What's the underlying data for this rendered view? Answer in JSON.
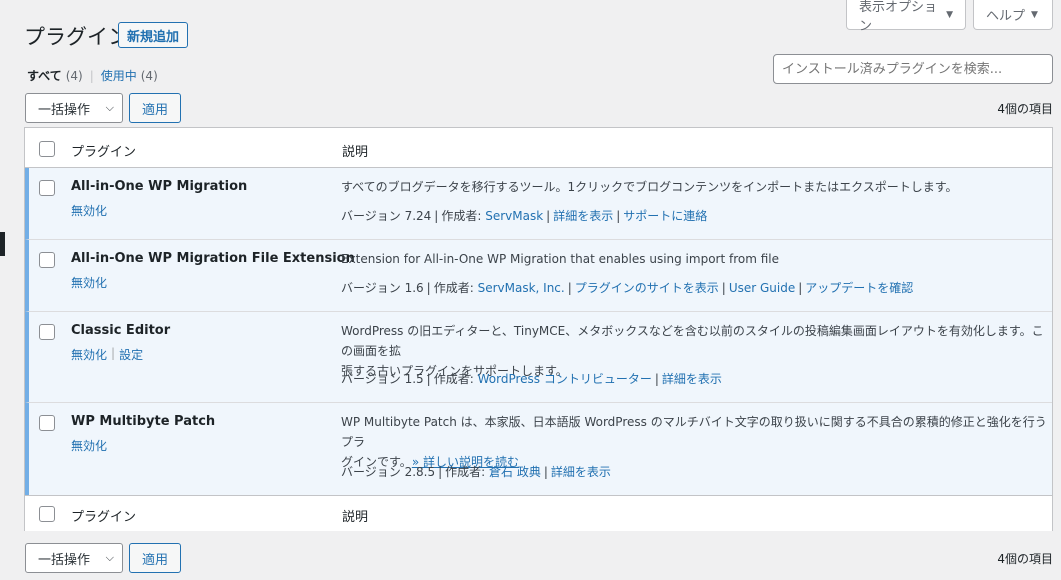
{
  "screen_meta": {
    "options_label": "表示オプション",
    "help_label": "ヘルプ"
  },
  "page": {
    "title": "プラグイン",
    "add_new_label": "新規追加"
  },
  "filters": {
    "all_label": "すべて",
    "all_count": "(4)",
    "separator": "|",
    "active_label": "使用中",
    "active_count": "(4)"
  },
  "search": {
    "placeholder": "インストール済みプラグインを検索..."
  },
  "tablenav": {
    "bulk_label": "一括操作",
    "apply_label": "適用",
    "items_count": "4個の項目"
  },
  "table": {
    "col_plugin": "プラグイン",
    "col_description": "説明",
    "plugins": [
      {
        "name": "All-in-One WP Migration",
        "actions": [
          "無効化"
        ],
        "description": "すべてのブログデータを移行するツール。1クリックでブログコンテンツをインポートまたはエクスポートします。",
        "version": "バージョン 7.24",
        "author_label": "作成者:",
        "author": "ServMask",
        "links": [
          "詳細を表示",
          "サポートに連絡"
        ]
      },
      {
        "name": "All-in-One WP Migration File Extension",
        "actions": [
          "無効化"
        ],
        "description": "Extension for All-in-One WP Migration that enables using import from file",
        "version": "バージョン 1.6",
        "author_label": "作成者:",
        "author": "ServMask, Inc.",
        "links": [
          "プラグインのサイトを表示",
          "User Guide",
          "アップデートを確認"
        ]
      },
      {
        "name": "Classic Editor",
        "actions": [
          "無効化",
          "設定"
        ],
        "description_line1": "WordPress の旧エディターと、TinyMCE、メタボックスなどを含む以前のスタイルの投稿編集画面レイアウトを有効化します。この画面を拡",
        "description_line2": "張する古いプラグインをサポートします。",
        "version": "バージョン 1.5",
        "author_label": "作成者:",
        "author": "WordPress コントリビューター",
        "links": [
          "詳細を表示"
        ]
      },
      {
        "name": "WP Multibyte Patch",
        "actions": [
          "無効化"
        ],
        "description_line1": "WP Multibyte Patch は、本家版、日本語版 WordPress のマルチバイト文字の取り扱いに関する不具合の累積的修正と強化を行うプラ",
        "description_line2": "グインです。",
        "read_more": "» 詳しい説明を読む",
        "version": "バージョン 2.8.5",
        "author_label": "作成者:",
        "author": "倉石 政典",
        "links": [
          "詳細を表示"
        ]
      }
    ]
  }
}
